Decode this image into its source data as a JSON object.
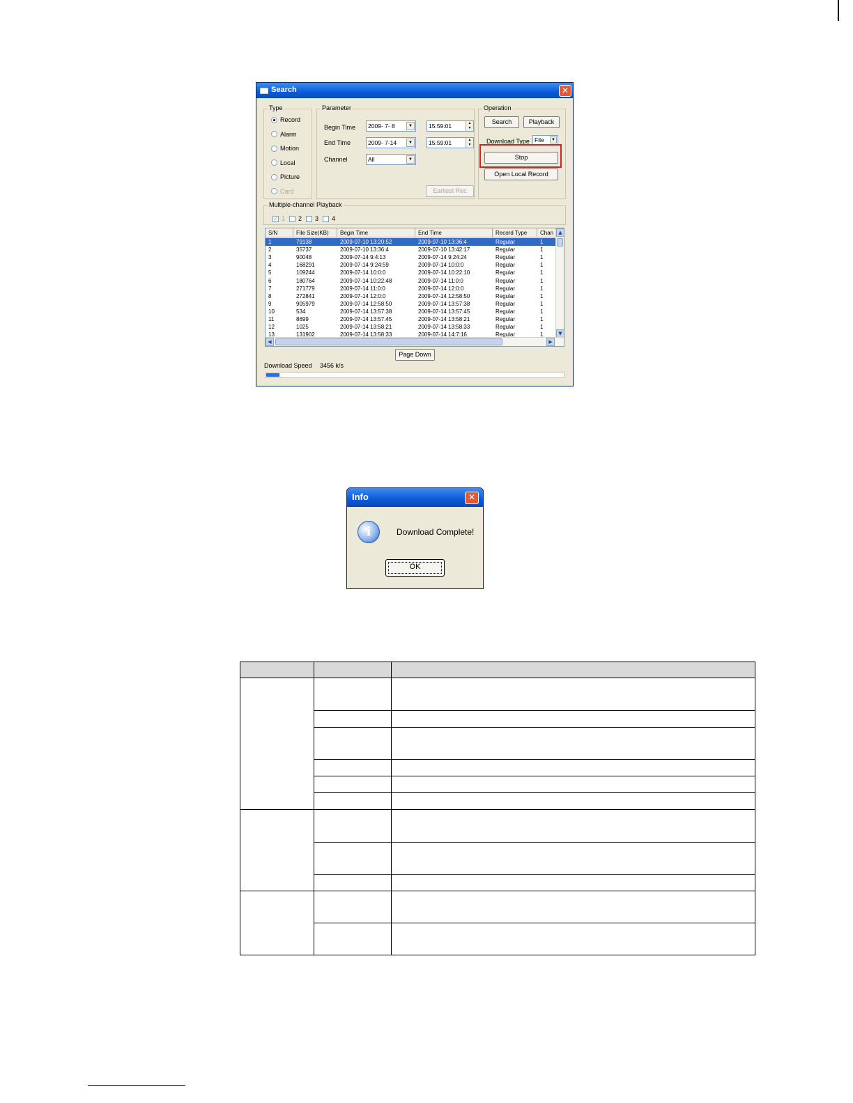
{
  "search_window": {
    "title": "Search",
    "type_group": {
      "label": "Type",
      "options": [
        {
          "label": "Record",
          "selected": true,
          "disabled": false
        },
        {
          "label": "Alarm",
          "selected": false,
          "disabled": false
        },
        {
          "label": "Motion",
          "selected": false,
          "disabled": false
        },
        {
          "label": "Local",
          "selected": false,
          "disabled": false
        },
        {
          "label": "Picture",
          "selected": false,
          "disabled": false
        },
        {
          "label": "Card",
          "selected": false,
          "disabled": true
        }
      ]
    },
    "parameter_group": {
      "label": "Parameter",
      "begin_time_label": "Begin Time",
      "begin_date": "2009- 7- 8",
      "begin_clock": "15:59:01",
      "end_time_label": "End Time",
      "end_date": "2009- 7-14",
      "end_clock": "15:59:01",
      "channel_label": "Channel",
      "channel_value": "All",
      "earliest_button": "Earliest Rec"
    },
    "operation_group": {
      "label": "Operation",
      "search_button": "Search",
      "playback_button": "Playback",
      "download_type_label": "Download Type",
      "download_type_value": "File",
      "stop_button": "Stop",
      "open_local_button": "Open Local Record"
    },
    "multi_channel": {
      "label": "Multiple-channel Playback",
      "channels": [
        {
          "label": "1",
          "checked": true
        },
        {
          "label": "2",
          "checked": false
        },
        {
          "label": "3",
          "checked": false
        },
        {
          "label": "4",
          "checked": false
        }
      ]
    },
    "record_list": {
      "columns": [
        "S/N",
        "File Size(KB)",
        "Begin Time",
        "End Time",
        "Record Type",
        "Chan"
      ],
      "rows": [
        [
          "1",
          "79138",
          "2009-07-10 13:20:52",
          "2009-07-10 13:36:4",
          "Regular",
          "1"
        ],
        [
          "2",
          "35737",
          "2009-07-10 13:36:4",
          "2009-07-10 13:42:17",
          "Regular",
          "1"
        ],
        [
          "3",
          "90048",
          "2009-07-14 9:4:13",
          "2009-07-14 9:24:24",
          "Regular",
          "1"
        ],
        [
          "4",
          "168291",
          "2009-07-14 9:24:59",
          "2009-07-14 10:0:0",
          "Regular",
          "1"
        ],
        [
          "5",
          "109244",
          "2009-07-14 10:0:0",
          "2009-07-14 10:22:10",
          "Regular",
          "1"
        ],
        [
          "6",
          "180764",
          "2009-07-14 10:22:48",
          "2009-07-14 11:0:0",
          "Regular",
          "1"
        ],
        [
          "7",
          "271779",
          "2009-07-14 11:0:0",
          "2009-07-14 12:0:0",
          "Regular",
          "1"
        ],
        [
          "8",
          "272841",
          "2009-07-14 12:0:0",
          "2009-07-14 12:58:50",
          "Regular",
          "1"
        ],
        [
          "9",
          "905979",
          "2009-07-14 12:58:50",
          "2009-07-14 13:57:38",
          "Regular",
          "1"
        ],
        [
          "10",
          "534",
          "2009-07-14 13:57:38",
          "2009-07-14 13:57:45",
          "Regular",
          "1"
        ],
        [
          "11",
          "8699",
          "2009-07-14 13:57:45",
          "2009-07-14 13:58:21",
          "Regular",
          "1"
        ],
        [
          "12",
          "1025",
          "2009-07-14 13:58:21",
          "2009-07-14 13:58:33",
          "Regular",
          "1"
        ],
        [
          "13",
          "131902",
          "2009-07-14 13:58:33",
          "2009-07-14 14:7:16",
          "Regular",
          "1"
        ]
      ],
      "selected_row": 0
    },
    "page_down_button": "Page Down",
    "download_speed_label": "Download Speed",
    "download_speed_value": "3456 k/s",
    "progress_fraction": 0.045
  },
  "info_dialog": {
    "title": "Info",
    "message": "Download Complete!",
    "ok_button": "OK"
  },
  "colors": {
    "titlebar": "#0a5bd8",
    "highlight_box": "#d82020",
    "selection": "#316ac5",
    "table_header": "#d9d9d9"
  }
}
